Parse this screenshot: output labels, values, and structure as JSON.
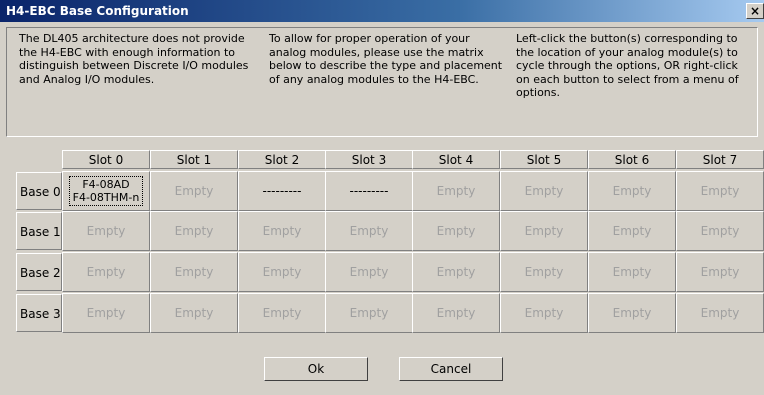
{
  "window": {
    "title": "H4-EBC Base Configuration",
    "close_label": "×"
  },
  "info": {
    "col1": "The DL405 architecture does not provide the H4-EBC with enough information to distinguish between Discrete I/O modules and Analog I/O modules.",
    "col2": "To allow for proper operation of your analog modules, please use the matrix below to describe the type and placement of any analog modules to the H4-EBC.",
    "col3": "Left-click the button(s) corresponding to the location of your analog module(s) to cycle through the options, OR right-click on each button to select from a menu of options."
  },
  "columns": [
    "Slot 0",
    "Slot 1",
    "Slot 2",
    "Slot 3",
    "Slot 4",
    "Slot 5",
    "Slot 6",
    "Slot 7"
  ],
  "rows": [
    {
      "label": "Base 0",
      "cells": [
        "F4-08AD\nF4-08THM-n",
        "Empty",
        "---------",
        "---------",
        "Empty",
        "Empty",
        "Empty",
        "Empty"
      ]
    },
    {
      "label": "Base 1",
      "cells": [
        "Empty",
        "Empty",
        "Empty",
        "Empty",
        "Empty",
        "Empty",
        "Empty",
        "Empty"
      ]
    },
    {
      "label": "Base 2",
      "cells": [
        "Empty",
        "Empty",
        "Empty",
        "Empty",
        "Empty",
        "Empty",
        "Empty",
        "Empty"
      ]
    },
    {
      "label": "Base 3",
      "cells": [
        "Empty",
        "Empty",
        "Empty",
        "Empty",
        "Empty",
        "Empty",
        "Empty",
        "Empty"
      ]
    }
  ],
  "buttons": {
    "ok": "Ok",
    "cancel": "Cancel"
  }
}
